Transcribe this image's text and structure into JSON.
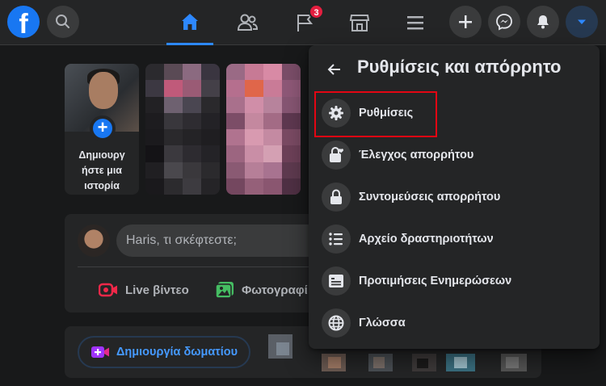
{
  "nav": {
    "logo_letter": "f",
    "notification_count": "3",
    "accent": "#2d88ff",
    "tabs": [
      {
        "icon": "home-icon",
        "active": true
      },
      {
        "icon": "friends-icon"
      },
      {
        "icon": "pages-flag-icon"
      },
      {
        "icon": "marketplace-icon"
      },
      {
        "icon": "menu-icon"
      }
    ],
    "right_buttons": [
      "plus-icon",
      "messenger-icon",
      "bell-icon",
      "caret-down-icon"
    ]
  },
  "stories": {
    "create_label": "Δημιουργήστε μια ιστορία",
    "create_label_lines": [
      "Δημιουργ",
      "ήστε μια",
      "ιστορία"
    ],
    "plus": "+"
  },
  "composer": {
    "placeholder": "Haris, τι σκέφτεστε;",
    "live_label": "Live βίντεο",
    "photo_label": "Φωτογραφί"
  },
  "rooms": {
    "button_label": "Δημιουργία δωματίου"
  },
  "settings_menu": {
    "title": "Ρυθμίσεις και απόρρητο",
    "items": [
      {
        "label": "Ρυθμίσεις",
        "icon": "gear-icon"
      },
      {
        "label": "Έλεγχος απορρήτου",
        "icon": "lock-heart-icon"
      },
      {
        "label": "Συντομεύσεις απορρήτου",
        "icon": "lock-icon"
      },
      {
        "label": "Αρχείο δραστηριοτήτων",
        "icon": "list-icon"
      },
      {
        "label": "Προτιμήσεις Ενημερώσεων",
        "icon": "news-feed-icon"
      },
      {
        "label": "Γλώσσα",
        "icon": "globe-icon"
      }
    ]
  },
  "colors": {
    "background": "#18191a",
    "surface": "#242526",
    "highlight_border": "#e30613",
    "notification_badge": "#e41e3f"
  }
}
